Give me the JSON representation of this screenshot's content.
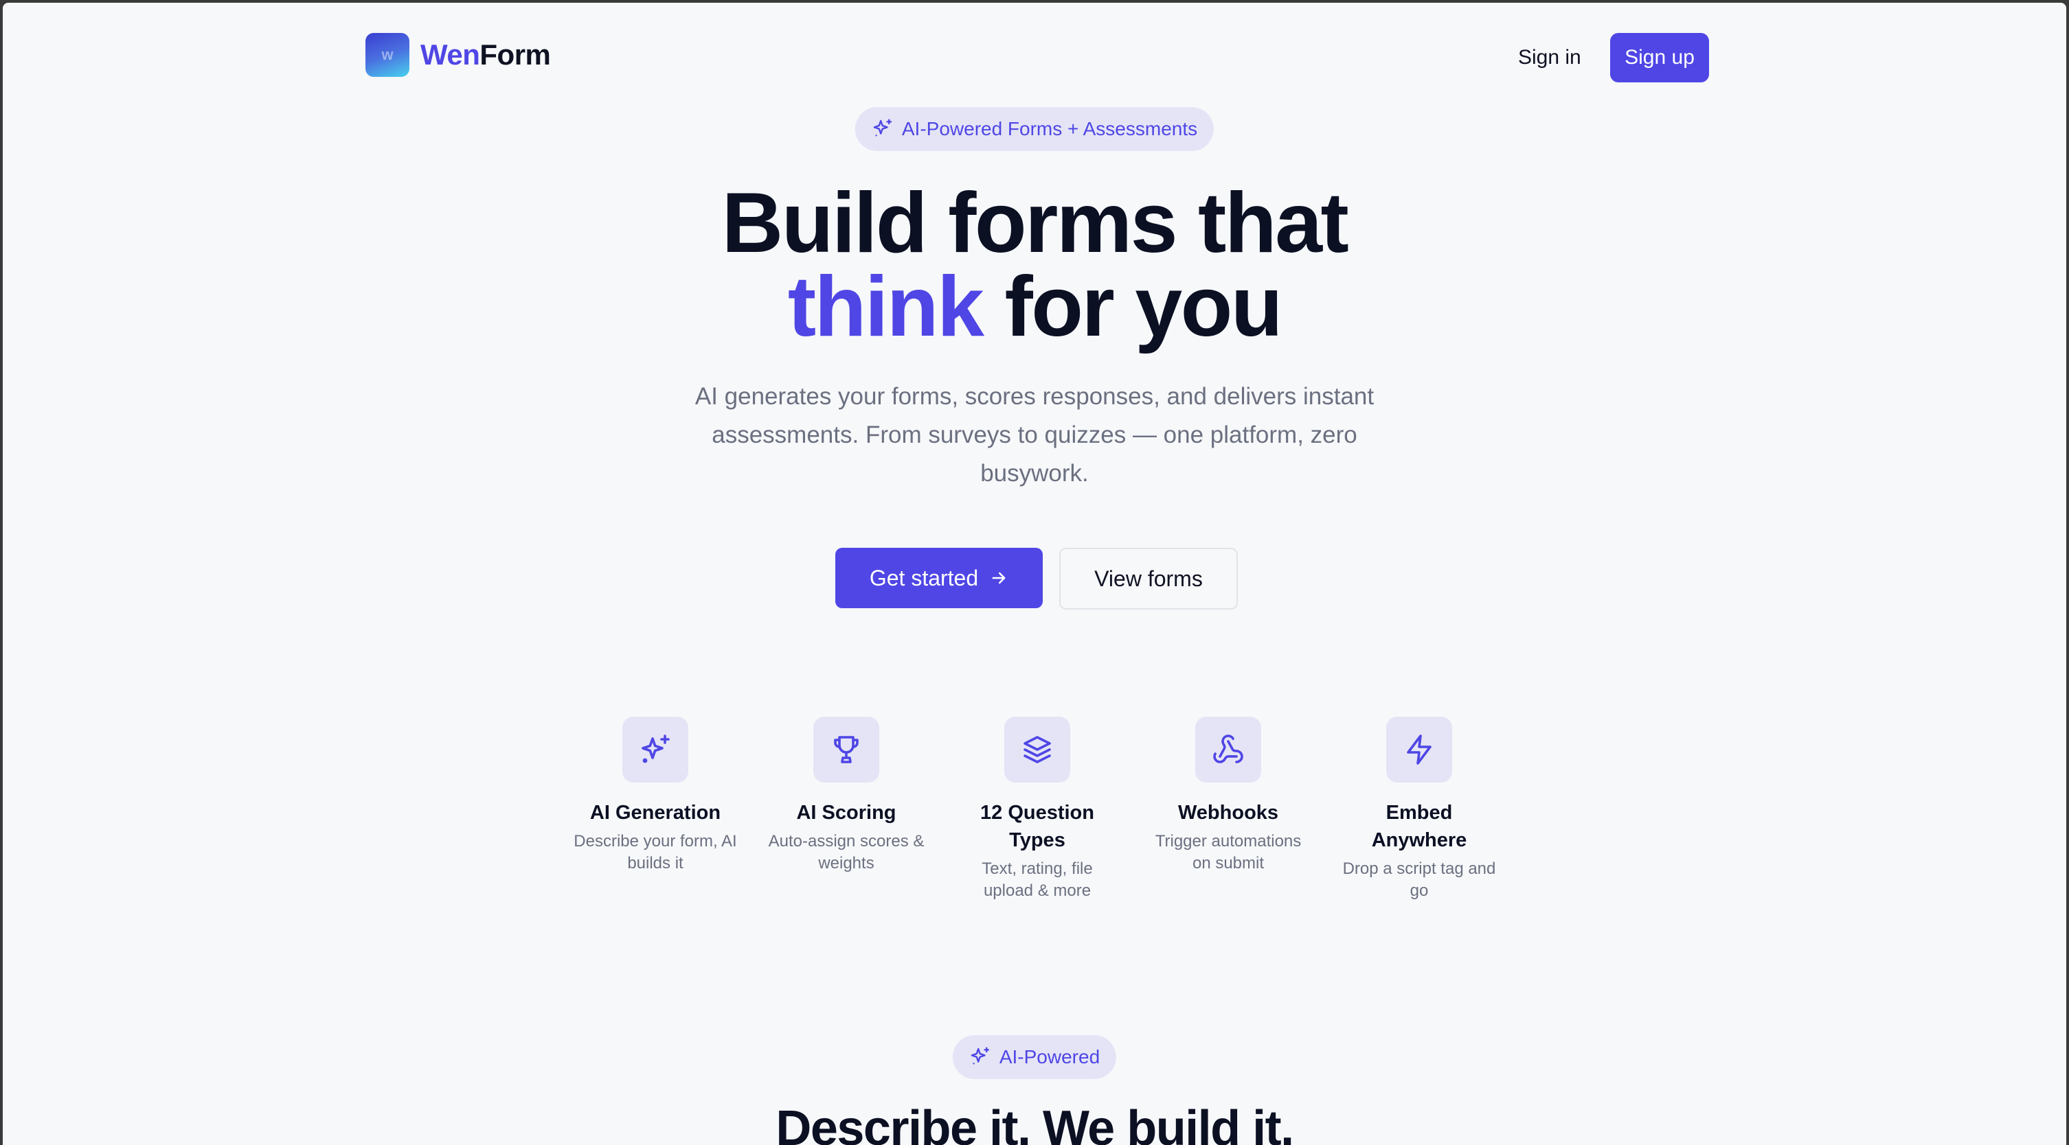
{
  "header": {
    "logo_initial": "w",
    "logo_name_accent": "Wen",
    "logo_name_rest": "Form",
    "signin_label": "Sign in",
    "signup_label": "Sign up"
  },
  "hero": {
    "badge": "AI-Powered Forms + Assessments",
    "title_line1": "Build forms that",
    "title_highlight": "think",
    "title_line2_rest": " for you",
    "subtitle": "AI generates your forms, scores responses, and delivers instant assessments. From surveys to quizzes — one platform, zero busywork.",
    "primary_cta": "Get started",
    "secondary_cta": "View forms"
  },
  "features": [
    {
      "icon": "sparkles-icon",
      "title": "AI Generation",
      "desc": "Describe your form, AI builds it"
    },
    {
      "icon": "trophy-icon",
      "title": "AI Scoring",
      "desc": "Auto-assign scores & weights"
    },
    {
      "icon": "layers-icon",
      "title": "12 Question Types",
      "desc": "Text, rating, file upload & more"
    },
    {
      "icon": "webhook-icon",
      "title": "Webhooks",
      "desc": "Trigger automations on submit"
    },
    {
      "icon": "lightning-icon",
      "title": "Embed Anywhere",
      "desc": "Drop a script tag and go"
    }
  ],
  "section2": {
    "badge": "AI-Powered",
    "heading": "Describe it. We build it."
  },
  "colors": {
    "accent": "#4f46e5",
    "background": "#f7f8fa",
    "badge_bg": "#e4e4f6",
    "text_dark": "#0b1023",
    "text_muted": "#6b7080"
  }
}
